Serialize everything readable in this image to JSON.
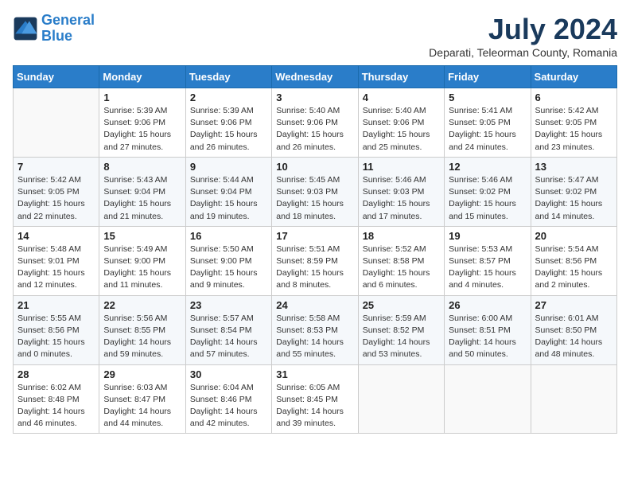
{
  "logo": {
    "line1": "General",
    "line2": "Blue"
  },
  "title": "July 2024",
  "subtitle": "Deparati, Teleorman County, Romania",
  "headers": [
    "Sunday",
    "Monday",
    "Tuesday",
    "Wednesday",
    "Thursday",
    "Friday",
    "Saturday"
  ],
  "weeks": [
    [
      {
        "day": "",
        "info": ""
      },
      {
        "day": "1",
        "info": "Sunrise: 5:39 AM\nSunset: 9:06 PM\nDaylight: 15 hours\nand 27 minutes."
      },
      {
        "day": "2",
        "info": "Sunrise: 5:39 AM\nSunset: 9:06 PM\nDaylight: 15 hours\nand 26 minutes."
      },
      {
        "day": "3",
        "info": "Sunrise: 5:40 AM\nSunset: 9:06 PM\nDaylight: 15 hours\nand 26 minutes."
      },
      {
        "day": "4",
        "info": "Sunrise: 5:40 AM\nSunset: 9:06 PM\nDaylight: 15 hours\nand 25 minutes."
      },
      {
        "day": "5",
        "info": "Sunrise: 5:41 AM\nSunset: 9:05 PM\nDaylight: 15 hours\nand 24 minutes."
      },
      {
        "day": "6",
        "info": "Sunrise: 5:42 AM\nSunset: 9:05 PM\nDaylight: 15 hours\nand 23 minutes."
      }
    ],
    [
      {
        "day": "7",
        "info": "Sunrise: 5:42 AM\nSunset: 9:05 PM\nDaylight: 15 hours\nand 22 minutes."
      },
      {
        "day": "8",
        "info": "Sunrise: 5:43 AM\nSunset: 9:04 PM\nDaylight: 15 hours\nand 21 minutes."
      },
      {
        "day": "9",
        "info": "Sunrise: 5:44 AM\nSunset: 9:04 PM\nDaylight: 15 hours\nand 19 minutes."
      },
      {
        "day": "10",
        "info": "Sunrise: 5:45 AM\nSunset: 9:03 PM\nDaylight: 15 hours\nand 18 minutes."
      },
      {
        "day": "11",
        "info": "Sunrise: 5:46 AM\nSunset: 9:03 PM\nDaylight: 15 hours\nand 17 minutes."
      },
      {
        "day": "12",
        "info": "Sunrise: 5:46 AM\nSunset: 9:02 PM\nDaylight: 15 hours\nand 15 minutes."
      },
      {
        "day": "13",
        "info": "Sunrise: 5:47 AM\nSunset: 9:02 PM\nDaylight: 15 hours\nand 14 minutes."
      }
    ],
    [
      {
        "day": "14",
        "info": "Sunrise: 5:48 AM\nSunset: 9:01 PM\nDaylight: 15 hours\nand 12 minutes."
      },
      {
        "day": "15",
        "info": "Sunrise: 5:49 AM\nSunset: 9:00 PM\nDaylight: 15 hours\nand 11 minutes."
      },
      {
        "day": "16",
        "info": "Sunrise: 5:50 AM\nSunset: 9:00 PM\nDaylight: 15 hours\nand 9 minutes."
      },
      {
        "day": "17",
        "info": "Sunrise: 5:51 AM\nSunset: 8:59 PM\nDaylight: 15 hours\nand 8 minutes."
      },
      {
        "day": "18",
        "info": "Sunrise: 5:52 AM\nSunset: 8:58 PM\nDaylight: 15 hours\nand 6 minutes."
      },
      {
        "day": "19",
        "info": "Sunrise: 5:53 AM\nSunset: 8:57 PM\nDaylight: 15 hours\nand 4 minutes."
      },
      {
        "day": "20",
        "info": "Sunrise: 5:54 AM\nSunset: 8:56 PM\nDaylight: 15 hours\nand 2 minutes."
      }
    ],
    [
      {
        "day": "21",
        "info": "Sunrise: 5:55 AM\nSunset: 8:56 PM\nDaylight: 15 hours\nand 0 minutes."
      },
      {
        "day": "22",
        "info": "Sunrise: 5:56 AM\nSunset: 8:55 PM\nDaylight: 14 hours\nand 59 minutes."
      },
      {
        "day": "23",
        "info": "Sunrise: 5:57 AM\nSunset: 8:54 PM\nDaylight: 14 hours\nand 57 minutes."
      },
      {
        "day": "24",
        "info": "Sunrise: 5:58 AM\nSunset: 8:53 PM\nDaylight: 14 hours\nand 55 minutes."
      },
      {
        "day": "25",
        "info": "Sunrise: 5:59 AM\nSunset: 8:52 PM\nDaylight: 14 hours\nand 53 minutes."
      },
      {
        "day": "26",
        "info": "Sunrise: 6:00 AM\nSunset: 8:51 PM\nDaylight: 14 hours\nand 50 minutes."
      },
      {
        "day": "27",
        "info": "Sunrise: 6:01 AM\nSunset: 8:50 PM\nDaylight: 14 hours\nand 48 minutes."
      }
    ],
    [
      {
        "day": "28",
        "info": "Sunrise: 6:02 AM\nSunset: 8:48 PM\nDaylight: 14 hours\nand 46 minutes."
      },
      {
        "day": "29",
        "info": "Sunrise: 6:03 AM\nSunset: 8:47 PM\nDaylight: 14 hours\nand 44 minutes."
      },
      {
        "day": "30",
        "info": "Sunrise: 6:04 AM\nSunset: 8:46 PM\nDaylight: 14 hours\nand 42 minutes."
      },
      {
        "day": "31",
        "info": "Sunrise: 6:05 AM\nSunset: 8:45 PM\nDaylight: 14 hours\nand 39 minutes."
      },
      {
        "day": "",
        "info": ""
      },
      {
        "day": "",
        "info": ""
      },
      {
        "day": "",
        "info": ""
      }
    ]
  ]
}
